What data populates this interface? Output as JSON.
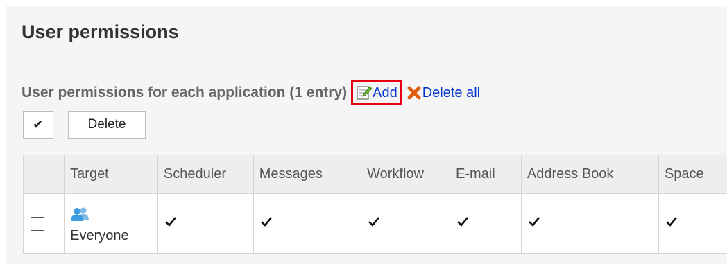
{
  "page": {
    "title": "User permissions"
  },
  "section": {
    "title": "User permissions for each application (1 entry)",
    "add_label": "Add",
    "delete_all_label": "Delete all"
  },
  "toolbar": {
    "select_all_label": "✔",
    "delete_label": "Delete"
  },
  "table": {
    "columns": [
      "",
      "Target",
      "Scheduler",
      "Messages",
      "Workflow",
      "E-mail",
      "Address Book",
      "Space"
    ],
    "rows": [
      {
        "target": "Everyone",
        "target_icon": "user-group-icon",
        "checked": false,
        "permissions": [
          true,
          true,
          true,
          true,
          true,
          true
        ]
      }
    ]
  },
  "colors": {
    "link": "#0033cc",
    "highlight": "#e60012",
    "delete_icon": "#e05a10",
    "user_icon": "#3d9be0",
    "panel": "#f5f5f5"
  }
}
